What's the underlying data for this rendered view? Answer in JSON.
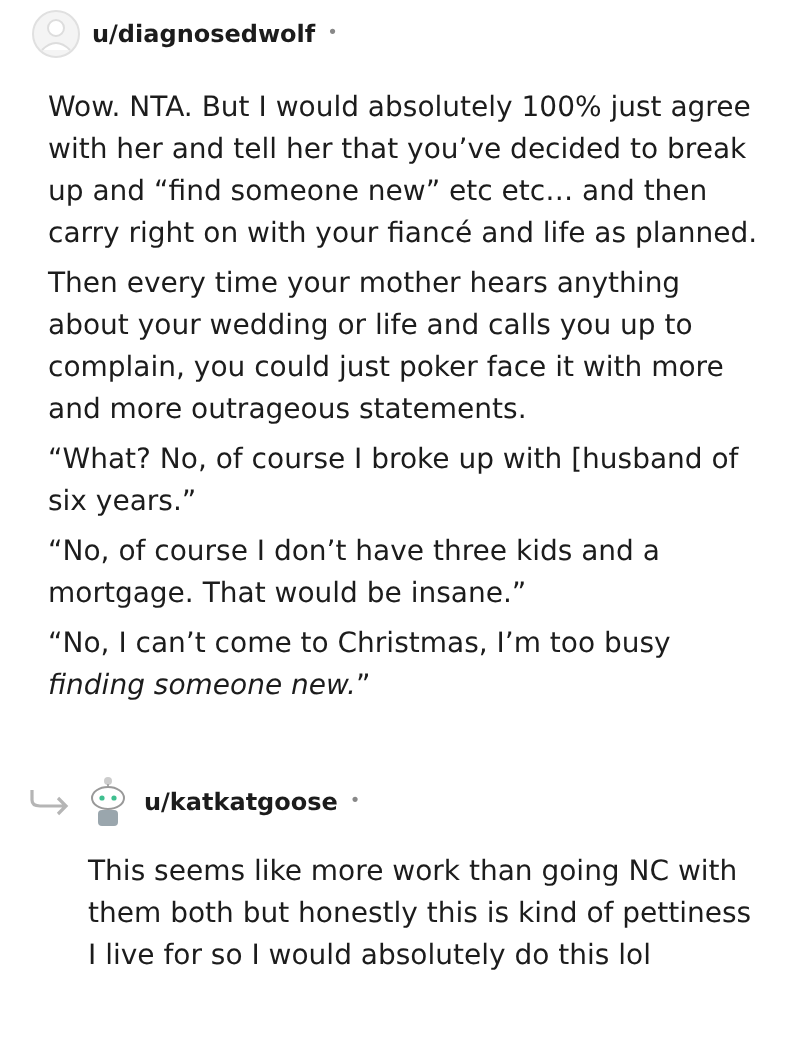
{
  "comments": [
    {
      "kind": "top",
      "author": "u/diagnosedwolf",
      "separator": "•",
      "paragraphs": [
        "Wow. NTA. But I would absolutely 100% just agree with her and tell her that you’ve decided to break up and “find someone new” etc etc… and then carry right on with your fiancé and life as planned.",
        "Then every time your mother hears anything about your wedding or life and calls you up to complain, you could just poker face it with more and more outrageous statements.",
        "“What? No, of course I broke up with [husband of six years.”",
        "“No, of course I don’t have three kids and a mortgage. That would be insane.”",
        "“No, I can’t come to Christmas, I’m too busy *finding someone new.*”"
      ]
    },
    {
      "kind": "reply",
      "author": "u/katkatgoose",
      "separator": "•",
      "paragraphs": [
        "This seems like more work than going NC with them both but honestly this is kind of pettiness I live for so I would absolutely do this lol"
      ]
    }
  ]
}
